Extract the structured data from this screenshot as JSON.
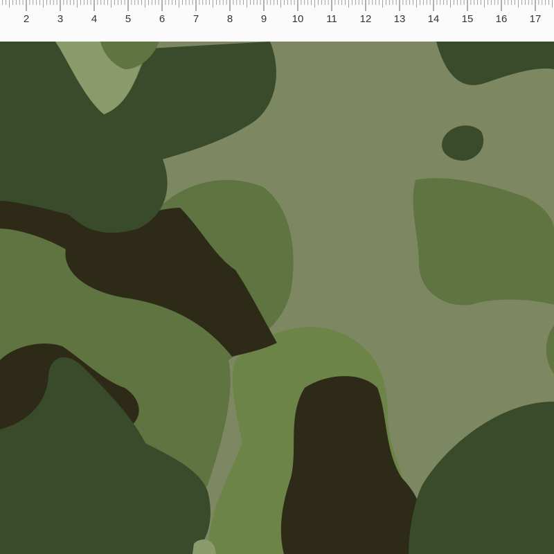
{
  "ruler": {
    "labels": [
      "2",
      "3",
      "4",
      "5",
      "6",
      "7",
      "8",
      "9",
      "10",
      "11",
      "12",
      "13",
      "14",
      "15",
      "16",
      "17"
    ]
  },
  "fabric": {
    "pattern": "woodland camouflage",
    "colors": {
      "light_sage": "#7d8863",
      "mid_olive": "#5f7440",
      "bright_olive": "#6d8448",
      "forest_green": "#394b2b",
      "dark_brown": "#2d2a17",
      "pale_sage": "#8a9a6a"
    }
  }
}
